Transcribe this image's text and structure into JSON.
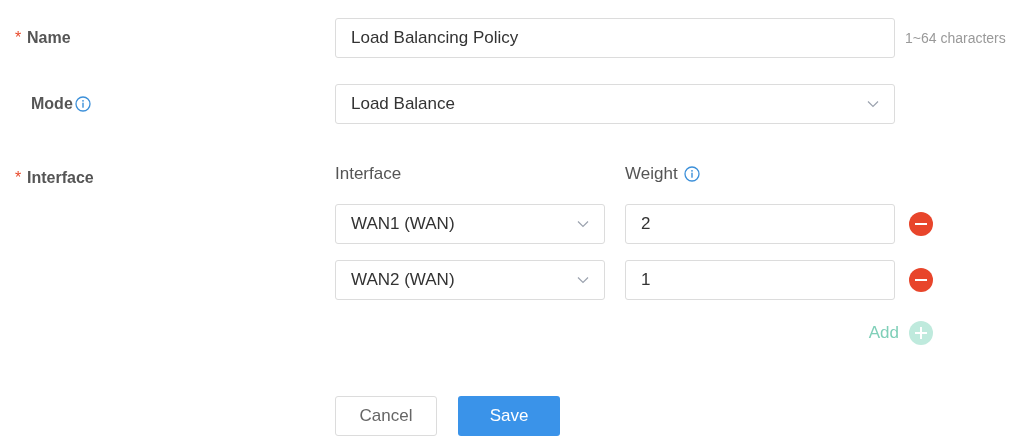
{
  "name_field": {
    "label": "Name",
    "marker": "*",
    "value": "Load Balancing Policy",
    "hint": "1~64 characters"
  },
  "mode_field": {
    "label": "Mode",
    "value": "Load Balance"
  },
  "interface_field": {
    "label": "Interface",
    "marker": "*",
    "columns": [
      "Interface",
      "Weight"
    ],
    "rows": [
      {
        "interface": "WAN1 (WAN)",
        "weight": "2"
      },
      {
        "interface": "WAN2 (WAN)",
        "weight": "1"
      }
    ],
    "add": {
      "label": "Add",
      "disabled": true
    }
  },
  "buttons": [
    {
      "label": "Cancel",
      "kind": "secondary"
    },
    {
      "label": "Save",
      "kind": "primary"
    }
  ]
}
